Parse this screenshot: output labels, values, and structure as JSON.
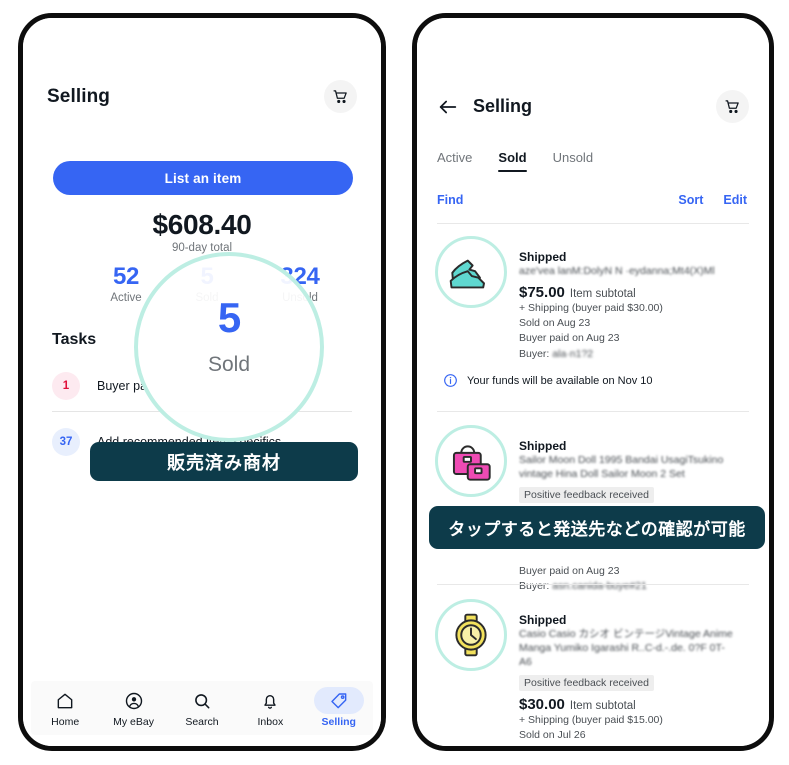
{
  "colors": {
    "brand_blue": "#3665f3",
    "ring_mint": "#bdeee3",
    "badge_teal": "#0d3b4a",
    "red": "#e0103a",
    "text_dark": "#111820",
    "text_grey": "#70757a"
  },
  "left_phone": {
    "header": {
      "title": "Selling",
      "cart_icon": "shopping-cart-icon"
    },
    "list_button": "List an item",
    "total": {
      "amount": "$608.40",
      "subtitle": "90-day total"
    },
    "stats": [
      {
        "key": "active",
        "value": "52",
        "label": "Active"
      },
      {
        "key": "sold",
        "value": "5",
        "label": "Sold"
      },
      {
        "key": "unsold",
        "value": "324",
        "label": "Unsold"
      }
    ],
    "highlight": {
      "value": "5",
      "label": "Sold"
    },
    "tasks_heading": "Tasks",
    "tasks": [
      {
        "count": "1",
        "label": "Buyer pa",
        "badge_color": "red"
      },
      {
        "count": "37",
        "label": "Add recommended item specifics",
        "badge_color": "blue"
      }
    ],
    "annotation": "販売済み商材",
    "bottom_nav": [
      {
        "label": "Home",
        "icon": "home-icon",
        "active": false
      },
      {
        "label": "My eBay",
        "icon": "account-circle-icon",
        "active": false
      },
      {
        "label": "Search",
        "icon": "search-icon",
        "active": false
      },
      {
        "label": "Inbox",
        "icon": "bell-icon",
        "active": false
      },
      {
        "label": "Selling",
        "icon": "tag-icon",
        "active": true
      }
    ]
  },
  "right_phone": {
    "header": {
      "back_icon": "back-arrow-icon",
      "title": "Selling",
      "cart_icon": "shopping-cart-icon"
    },
    "tabs": [
      {
        "label": "Active",
        "active": false
      },
      {
        "label": "Sold",
        "active": true
      },
      {
        "label": "Unsold",
        "active": false
      }
    ],
    "toolbar": {
      "find": "Find",
      "sort": "Sort",
      "edit": "Edit"
    },
    "listings": [
      {
        "icon": "sneakers-icon",
        "status": "Shipped",
        "title": "aze'vea lanM:DolyN N ·eydan\u000bna;Mt4(X)Ml",
        "feedback": "",
        "price": "$75.00",
        "price_label": "Item subtotal",
        "shipping": "+ Shipping (buyer paid $30.00)",
        "sold_on": "Sold on Aug 23",
        "buyer_paid": "Buyer paid on Aug 23",
        "buyer_label": "Buyer:",
        "buyer_value": "ala·n1?2",
        "note_icon": "info-icon",
        "note": "Your funds will be available on Nov 10"
      },
      {
        "icon": "handbag-icon",
        "status": "Shipped",
        "title": "Sailor Moon Doll 1995 Bandai Usagi\u000bTsukino vintage Hina Doll Sailor Moon 2 Set",
        "feedback": "Positive feedback received",
        "price": "",
        "price_label": "",
        "shipping": "",
        "sold_on": "",
        "buyer_paid": "Buyer paid on Aug 23",
        "buyer_label": "Buyer:",
        "buyer_value": "asn.canida-buye#21",
        "note_icon": "",
        "note": ""
      },
      {
        "icon": "watch-icon",
        "status": "Shipped",
        "title": "Casio Casio カシオ ビンテージ\u000bVintage Anime Manga Yumiko Igarashi R..\u000bC-d.-.de. 0?F 0T-A6",
        "feedback": "Positive feedback received",
        "price": "$30.00",
        "price_label": "Item subtotal",
        "shipping": "+ Shipping (buyer paid $15.00)",
        "sold_on": "Sold on Jul 26",
        "buyer_paid": "",
        "buyer_label": "",
        "buyer_value": "",
        "note_icon": "",
        "note": ""
      }
    ],
    "annotation": "タップすると発送先などの確認が可能"
  }
}
